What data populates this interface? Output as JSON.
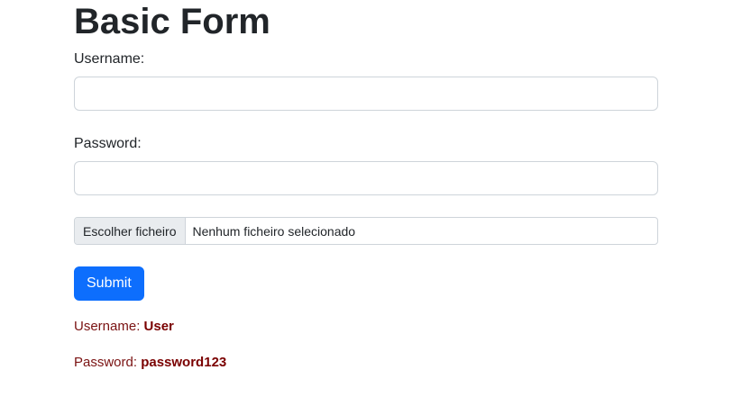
{
  "page": {
    "title": "Basic Form"
  },
  "form": {
    "username_label": "Username:",
    "username_value": "",
    "password_label": "Password:",
    "password_value": "",
    "file_button_label": "Escolher ficheiro",
    "file_status": "Nenhum ficheiro selecionado",
    "submit_label": "Submit"
  },
  "results": {
    "username_label": "Username:",
    "username_value": "User",
    "password_label": "Password:",
    "password_value": "password123"
  },
  "colors": {
    "primary": "#0d6efd",
    "result_text": "#7a1212"
  }
}
